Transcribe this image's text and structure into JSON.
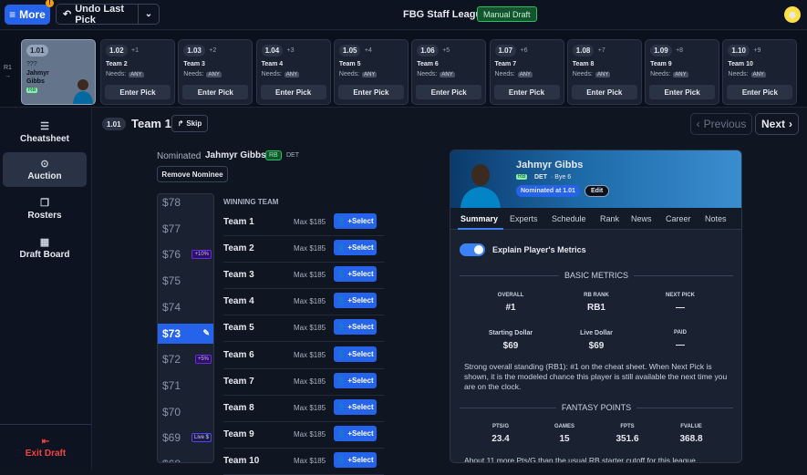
{
  "topbar": {
    "more_label": "More",
    "more_badge": "!",
    "undo_label": "Undo Last Pick",
    "league_title": "FBG Staff League",
    "mode_badge": "Manual Draft"
  },
  "picks_row": {
    "round_label": "R1",
    "round_arrow": "→",
    "first_pick": {
      "num": "1.01",
      "unknown": "???",
      "first_name": "Jahmyr",
      "last_name": "Gibbs",
      "pos": "RB"
    },
    "picks": [
      {
        "num": "1.02",
        "offset": "+1",
        "team": "Team 2",
        "needs": "Needs:",
        "any": "ANY",
        "enter": "Enter Pick"
      },
      {
        "num": "1.03",
        "offset": "+2",
        "team": "Team 3",
        "needs": "Needs:",
        "any": "ANY",
        "enter": "Enter Pick"
      },
      {
        "num": "1.04",
        "offset": "+3",
        "team": "Team 4",
        "needs": "Needs:",
        "any": "ANY",
        "enter": "Enter Pick"
      },
      {
        "num": "1.05",
        "offset": "+4",
        "team": "Team 5",
        "needs": "Needs:",
        "any": "ANY",
        "enter": "Enter Pick"
      },
      {
        "num": "1.06",
        "offset": "+5",
        "team": "Team 6",
        "needs": "Needs:",
        "any": "ANY",
        "enter": "Enter Pick"
      },
      {
        "num": "1.07",
        "offset": "+6",
        "team": "Team 7",
        "needs": "Needs:",
        "any": "ANY",
        "enter": "Enter Pick"
      },
      {
        "num": "1.08",
        "offset": "+7",
        "team": "Team 8",
        "needs": "Needs:",
        "any": "ANY",
        "enter": "Enter Pick"
      },
      {
        "num": "1.09",
        "offset": "+8",
        "team": "Team 9",
        "needs": "Needs:",
        "any": "ANY",
        "enter": "Enter Pick"
      },
      {
        "num": "1.10",
        "offset": "+9",
        "team": "Team 10",
        "needs": "Needs:",
        "any": "ANY",
        "enter": "Enter Pick"
      }
    ]
  },
  "sidebar": {
    "items": [
      {
        "label": "Cheatsheet",
        "icon": "list-icon"
      },
      {
        "label": "Auction",
        "icon": "check-circle-icon"
      },
      {
        "label": "Rosters",
        "icon": "copy-icon"
      },
      {
        "label": "Draft Board",
        "icon": "grid-icon"
      }
    ],
    "exit_label": "Exit Draft"
  },
  "header": {
    "pick_num": "1.01",
    "team": "Team 1",
    "skip_label": "Skip",
    "prev_label": "Previous",
    "next_label": "Next"
  },
  "nomination": {
    "label": "Nominated",
    "player": "Jahmyr Gibbs",
    "pos": "RB",
    "team": "DET",
    "remove_label": "Remove Nominee"
  },
  "prices": [
    {
      "label": "$78"
    },
    {
      "label": "$77"
    },
    {
      "label": "$76",
      "tag": "+10%"
    },
    {
      "label": "$75"
    },
    {
      "label": "$74"
    },
    {
      "label": "$73",
      "selected": true
    },
    {
      "label": "$72",
      "tag": "+5%"
    },
    {
      "label": "$71"
    },
    {
      "label": "$70"
    },
    {
      "label": "$69",
      "tag": "Live $"
    },
    {
      "label": "$68"
    }
  ],
  "winning": {
    "header": "WINNING TEAM",
    "select_label": "+Select",
    "teams": [
      {
        "name": "Team 1",
        "max": "Max $185"
      },
      {
        "name": "Team 2",
        "max": "Max $185"
      },
      {
        "name": "Team 3",
        "max": "Max $185"
      },
      {
        "name": "Team 4",
        "max": "Max $185"
      },
      {
        "name": "Team 5",
        "max": "Max $185"
      },
      {
        "name": "Team 6",
        "max": "Max $185"
      },
      {
        "name": "Team 7",
        "max": "Max $185"
      },
      {
        "name": "Team 8",
        "max": "Max $185"
      },
      {
        "name": "Team 9",
        "max": "Max $185"
      },
      {
        "name": "Team 10",
        "max": "Max $185"
      }
    ]
  },
  "player_card": {
    "name": "Jahmyr Gibbs",
    "pos": "RB",
    "team": "DET",
    "bye": "· Bye 6",
    "nominated_badge": "Nominated at 1.01",
    "edit_label": "Edit",
    "tabs": [
      "Summary",
      "Experts",
      "Schedule",
      "Rank",
      "News",
      "Career",
      "Notes"
    ],
    "toggle_label": "Explain Player's Metrics",
    "basic_title": "BASIC METRICS",
    "basic": [
      {
        "label": "OVERALL",
        "value": "#1"
      },
      {
        "label": "RB RANK",
        "value": "RB1"
      },
      {
        "label": "NEXT PICK",
        "value": "—"
      },
      {
        "label": "Starting Dollar",
        "value": "$69"
      },
      {
        "label": "Live Dollar",
        "value": "$69"
      },
      {
        "label": "PAID",
        "value": "—"
      }
    ],
    "explain": "Strong overall standing (RB1): #1 on the cheat sheet. When Next Pick is shown, it is the modeled chance this player is still available the next time you are on the clock.",
    "fantasy_title": "FANTASY POINTS",
    "fantasy": [
      {
        "label": "PTS/G",
        "value": "23.4"
      },
      {
        "label": "GAMES",
        "value": "15"
      },
      {
        "label": "FPTS",
        "value": "351.6"
      },
      {
        "label": "FVALUE",
        "value": "368.8"
      }
    ],
    "trailing": "About 11 more Pts/G than the usual RB starter cutoff for this league"
  },
  "colors": {
    "accent": "#2563eb",
    "danger": "#ef4444",
    "bg": "#0f1521"
  }
}
